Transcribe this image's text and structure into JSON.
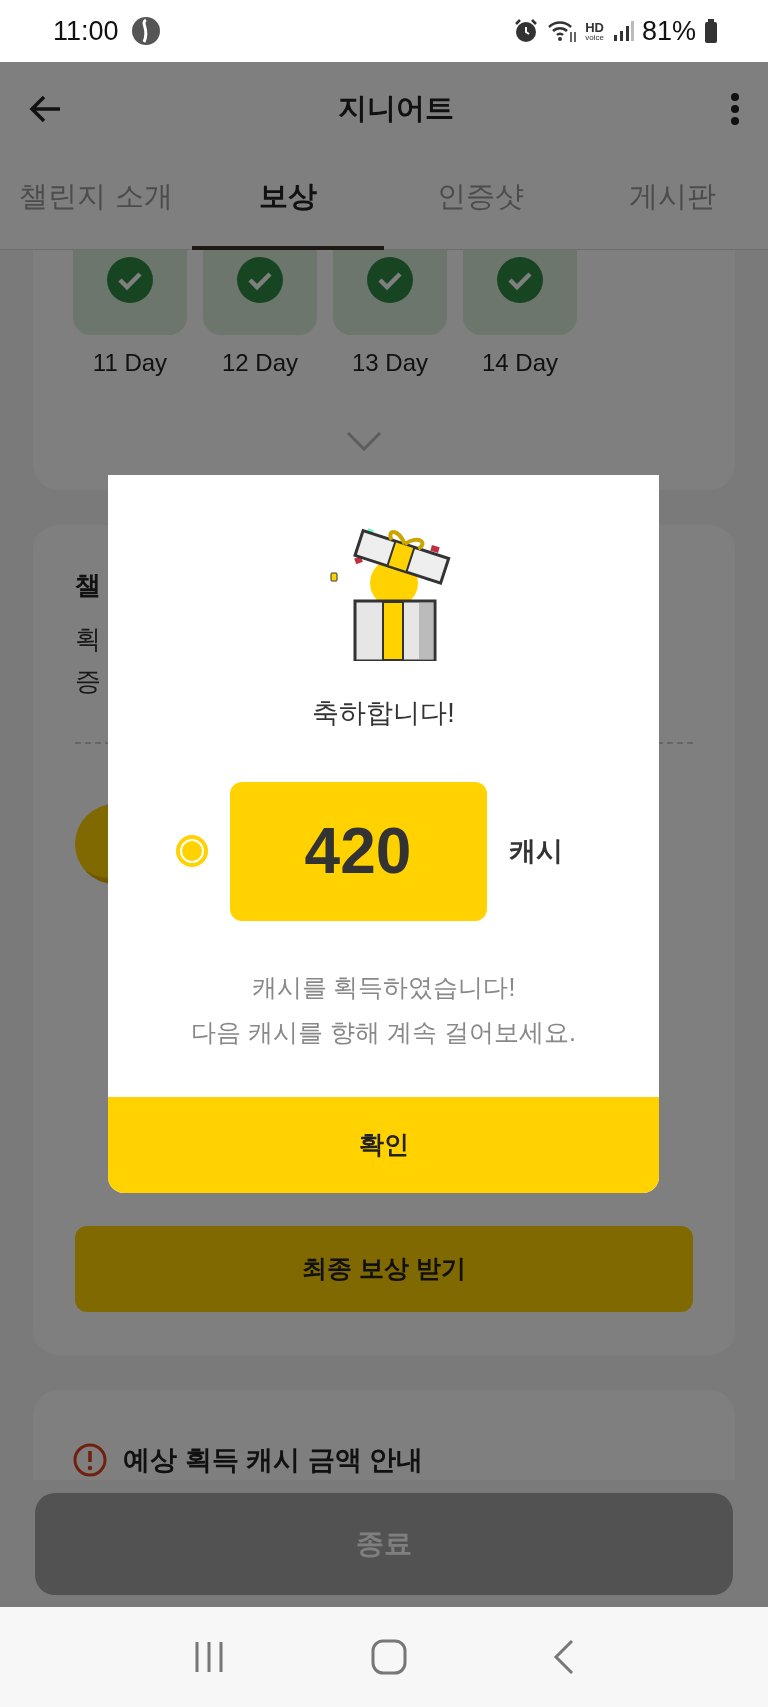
{
  "status_bar": {
    "time": "11:00",
    "hd_label": "HD",
    "voice_label": "voice",
    "battery": "81%"
  },
  "app_bar": {
    "title": "지니어트"
  },
  "tabs": [
    {
      "label": "챌린지 소개",
      "selected": false
    },
    {
      "label": "보상",
      "selected": true
    },
    {
      "label": "인증샷",
      "selected": false
    },
    {
      "label": "게시판",
      "selected": false
    }
  ],
  "days": [
    {
      "label": "11 Day",
      "done": true
    },
    {
      "label": "12 Day",
      "done": true
    },
    {
      "label": "13 Day",
      "done": true
    },
    {
      "label": "14 Day",
      "done": true
    }
  ],
  "challenge_card": {
    "title": "챌",
    "lines": [
      "획",
      "증"
    ]
  },
  "final_reward_button": "최종 보상 받기",
  "notice": {
    "title": "예상 획득 캐시 금액 안내"
  },
  "end_button": {
    "label": "종료",
    "disabled": true
  },
  "dialog": {
    "heading": "축하합니다!",
    "amount": "420",
    "unit": "캐시",
    "message": [
      "캐시를 획득하였습니다!",
      "다음 캐시를 향해 계속 걸어보세요."
    ],
    "confirm": "확인"
  }
}
